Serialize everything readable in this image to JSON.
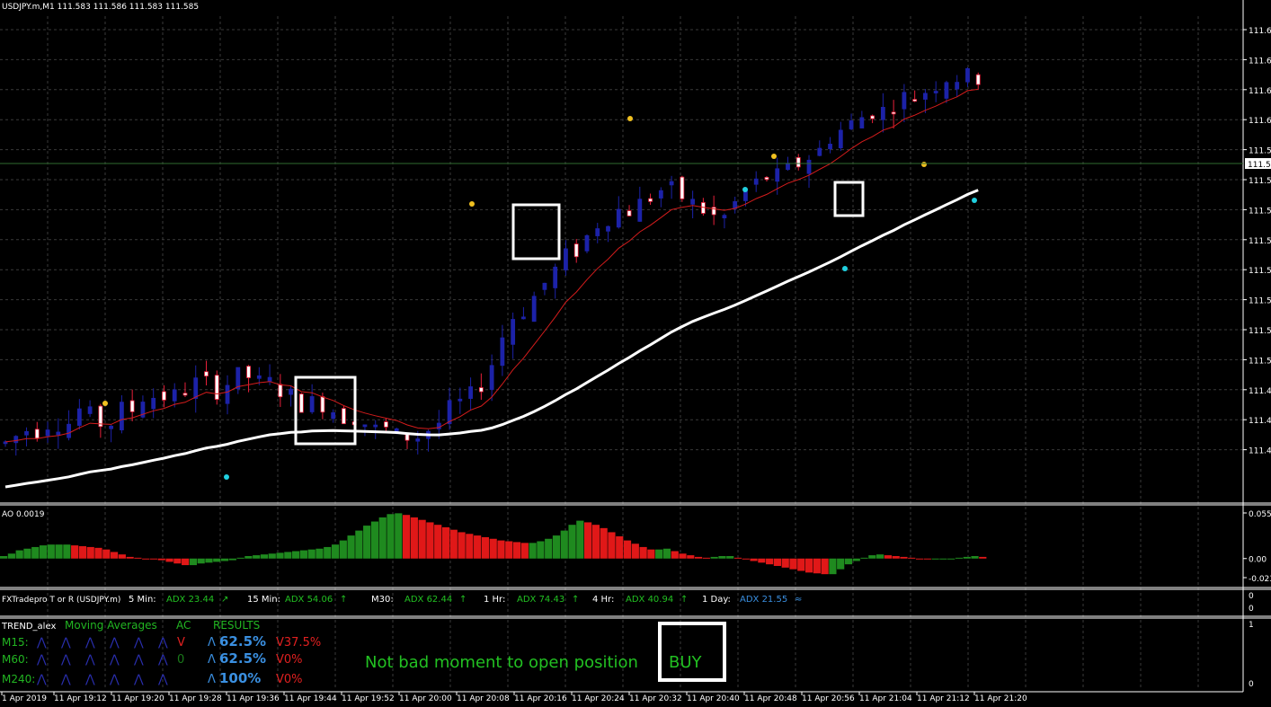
{
  "main": {
    "header": "USDJPY.m,M1  111.583 111.586 111.583 111.585",
    "price_ticks": [
      "111.6",
      "111.6",
      "111.6",
      "111.6",
      "111.5",
      "111.5",
      "111.5",
      "111.5",
      "111.5",
      "111.5",
      "111.5",
      "111.5",
      "111.4",
      "111.4",
      "111.4"
    ],
    "current_price": "111.5"
  },
  "ao_panel": {
    "header": "AO 0.0019",
    "ticks": [
      "0.0554",
      "0.00",
      "-0.0232"
    ]
  },
  "fx_panel": {
    "name": "FXTradepro T or R (USDJPY.m)",
    "items": [
      {
        "tf": "5 Min:",
        "adx": "ADX 23.44",
        "arrow": "↗",
        "color": "#22c022"
      },
      {
        "tf": "15 Min:",
        "adx": "ADX 54.06",
        "arrow": "↑",
        "color": "#22c022"
      },
      {
        "tf": "M30:",
        "adx": "ADX 62.44",
        "arrow": "↑",
        "color": "#22c022"
      },
      {
        "tf": "1 Hr:",
        "adx": "ADX 74.43",
        "arrow": "↑",
        "color": "#22c022"
      },
      {
        "tf": "4 Hr:",
        "adx": "ADX 40.94",
        "arrow": "↑",
        "color": "#22c022"
      },
      {
        "tf": "1 Day:",
        "adx": "ADX 21.55",
        "arrow": "≈",
        "color": "#3a8fe0"
      }
    ],
    "ticks": [
      "0",
      "0"
    ]
  },
  "trend_panel": {
    "title": "TREND_alex",
    "col_ma": "Moving Averages",
    "col_ac": "AC",
    "col_results": "RESULTS",
    "rows": [
      {
        "tf": "M15:",
        "ac": "V",
        "ac_color": "#e02020",
        "up": "62.5%",
        "down": "37.5%"
      },
      {
        "tf": "M60:",
        "ac": "0",
        "ac_color": "#1a7a1a",
        "up": "62.5%",
        "down": "0%"
      },
      {
        "tf": "M240:",
        "ac": "",
        "ac_color": "#1a7a1a",
        "up": "100%",
        "down": "0%"
      }
    ],
    "up_glyph": "Λ",
    "down_glyph": "V",
    "message": "Not bad moment to open position",
    "signal": "BUY",
    "ticks": [
      "1",
      "0"
    ]
  },
  "time_axis": [
    "1 Apr 2019",
    "11 Apr 19:12",
    "11 Apr 19:20",
    "11 Apr 19:28",
    "11 Apr 19:36",
    "11 Apr 19:44",
    "11 Apr 19:52",
    "11 Apr 20:00",
    "11 Apr 20:08",
    "11 Apr 20:16",
    "11 Apr 20:24",
    "11 Apr 20:32",
    "11 Apr 20:40",
    "11 Apr 20:48",
    "11 Apr 20:56",
    "11 Apr 21:04",
    "11 Apr 21:12",
    "11 Apr 21:20"
  ],
  "colors": {
    "background": "#000000",
    "grid": "#3a3a3a",
    "bull_candle": "#1c22a8",
    "bear_candle_body": "#ffffff",
    "bear_candle_wick": "#e8203a",
    "fast_ma": "#d41c1c",
    "slow_ma": "#ffffff",
    "ao_up": "#1f8a1f",
    "ao_down": "#e01818",
    "dot_yellow": "#f0c020",
    "dot_cyan": "#20d0e0"
  },
  "chart_data": [
    {
      "type": "candlestick",
      "symbol": "USDJPY.m",
      "timeframe": "M1",
      "ohlc_last": {
        "open": 111.583,
        "high": 111.586,
        "low": 111.583,
        "close": 111.585
      },
      "x_range": [
        "11 Apr 19:04",
        "11 Apr 21:22"
      ],
      "series_shape": {
        "close_levels": [
          7,
          8,
          9,
          9,
          10,
          10,
          10,
          12,
          11,
          10,
          10,
          12,
          12,
          14,
          14,
          14,
          14,
          15,
          16,
          16,
          15,
          16,
          17,
          17,
          16,
          16,
          15,
          14,
          13,
          13,
          13,
          12,
          11,
          11,
          10,
          9,
          9,
          8,
          8,
          8,
          9,
          10,
          12,
          13,
          14,
          16,
          19,
          23,
          26,
          27,
          29,
          31,
          33,
          35,
          36,
          38,
          40,
          41,
          42,
          42,
          43,
          44,
          45,
          45,
          44,
          43,
          42,
          41,
          41,
          43,
          45,
          46,
          47,
          47,
          48,
          49,
          50,
          51,
          53,
          54,
          55,
          56,
          57,
          57,
          58,
          59,
          59,
          60,
          61,
          62,
          62,
          62,
          62
        ],
        "note_levels": "relative 0-100 scale within the plot"
      },
      "signal_dots": [
        {
          "color": "yellow",
          "time": "11 Apr 19:13"
        },
        {
          "color": "cyan",
          "time": "11 Apr 19:32"
        },
        {
          "color": "yellow",
          "time": "11 Apr 20:10"
        },
        {
          "color": "yellow",
          "time": "11 Apr 20:25"
        },
        {
          "color": "cyan",
          "time": "11 Apr 20:44"
        },
        {
          "color": "yellow",
          "time": "11 Apr 20:47"
        },
        {
          "color": "cyan",
          "time": "11 Apr 20:57"
        },
        {
          "color": "yellow",
          "time": "11 Apr 21:08"
        },
        {
          "color": "cyan",
          "time": "11 Apr 21:18"
        }
      ],
      "highlight_boxes_count": 4
    },
    {
      "type": "bar",
      "name": "AO",
      "ylim": [
        -0.0232,
        0.0554
      ],
      "last_value": 0.0019,
      "values": [
        0.003,
        0.006,
        0.01,
        0.012,
        0.014,
        0.016,
        0.017,
        0.017,
        0.017,
        0.016,
        0.015,
        0.014,
        0.013,
        0.011,
        0.008,
        0.005,
        0.002,
        0.001,
        0.0,
        -0.001,
        -0.002,
        -0.004,
        -0.006,
        -0.008,
        -0.008,
        -0.006,
        -0.005,
        -0.004,
        -0.003,
        -0.002,
        0.001,
        0.003,
        0.004,
        0.005,
        0.006,
        0.007,
        0.008,
        0.009,
        0.01,
        0.011,
        0.012,
        0.014,
        0.017,
        0.022,
        0.028,
        0.034,
        0.04,
        0.045,
        0.05,
        0.054,
        0.055,
        0.053,
        0.05,
        0.047,
        0.044,
        0.041,
        0.038,
        0.035,
        0.032,
        0.03,
        0.028,
        0.026,
        0.024,
        0.022,
        0.021,
        0.02,
        0.019,
        0.019,
        0.021,
        0.024,
        0.028,
        0.034,
        0.041,
        0.046,
        0.044,
        0.041,
        0.037,
        0.032,
        0.027,
        0.022,
        0.018,
        0.014,
        0.011,
        0.011,
        0.012,
        0.009,
        0.006,
        0.004,
        0.002,
        0.001,
        0.002,
        0.003,
        0.003,
        0.001,
        -0.001,
        -0.003,
        -0.005,
        -0.007,
        -0.009,
        -0.011,
        -0.013,
        -0.015,
        -0.017,
        -0.018,
        -0.019,
        -0.019,
        -0.013,
        -0.007,
        -0.003,
        0.001,
        0.004,
        0.005,
        0.004,
        0.003,
        0.002,
        0.001,
        0.0,
        -0.001,
        -0.001,
        -0.001,
        0.0,
        0.001,
        0.002,
        0.003,
        0.002
      ]
    }
  ]
}
